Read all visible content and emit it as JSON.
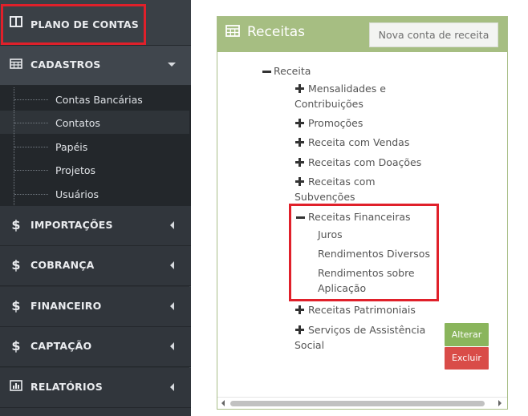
{
  "sidebar": {
    "plano": {
      "label": "PLANO DE CONTAS",
      "icon": "columns-icon"
    },
    "cadastros": {
      "label": "CADASTROS",
      "icon": "table-icon"
    },
    "submenu": [
      "Contas Bancárias",
      "Contatos",
      "Papéis",
      "Projetos",
      "Usuários"
    ],
    "items": [
      {
        "label": "IMPORTAÇÕES",
        "icon": "dollar-icon"
      },
      {
        "label": "COBRANÇA",
        "icon": "dollar-icon"
      },
      {
        "label": "FINANCEIRO",
        "icon": "dollar-icon"
      },
      {
        "label": "CAPTAÇÃO",
        "icon": "dollar-icon"
      },
      {
        "label": "RELATÓRIOS",
        "icon": "bar-chart-icon"
      }
    ]
  },
  "panel": {
    "title": "Receitas",
    "new_button": "Nova conta de receita",
    "tree": {
      "root": "Receita",
      "n1": "Mensalidades e",
      "n1b": "Contribuições",
      "n2": "Promoções",
      "n3": "Receita com Vendas",
      "n4": "Receitas com Doações",
      "n5": "Receitas com",
      "n5b": "Subvenções",
      "n6": "Receitas Financeiras",
      "n6c1": "Juros",
      "n6c2": "Rendimentos Diversos",
      "n6c3": "Rendimentos sobre",
      "n6c3b": "Aplicação",
      "n7": "Receitas Patrimoniais",
      "n8": "Serviços de Assistência",
      "n8b": "Social"
    },
    "btn_alterar": "Alterar",
    "btn_excluir": "Excluir"
  },
  "colors": {
    "highlight": "#e0202a",
    "panel_header": "#a6be82",
    "sidebar": "#2b3035"
  }
}
